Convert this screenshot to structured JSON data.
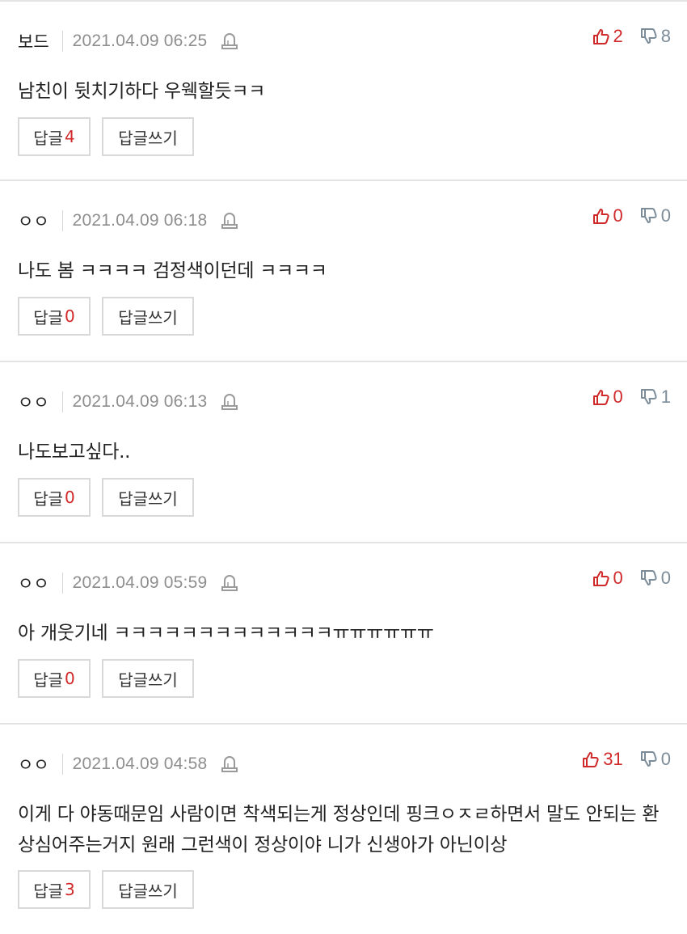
{
  "comments": [
    {
      "author": "보드",
      "date": "2021.04.09 06:25",
      "likes": "2",
      "dislikes": "8",
      "text": "남친이 뒷치기하다 우웩할듯ㅋㅋ",
      "reply_label": "답글",
      "reply_count": "4",
      "write_label": "답글쓰기"
    },
    {
      "author": "ㅇㅇ",
      "date": "2021.04.09 06:18",
      "likes": "0",
      "dislikes": "0",
      "text": "나도 봄 ㅋㅋㅋㅋ 검정색이던데 ㅋㅋㅋㅋ",
      "reply_label": "답글",
      "reply_count": "0",
      "write_label": "답글쓰기"
    },
    {
      "author": "ㅇㅇ",
      "date": "2021.04.09 06:13",
      "likes": "0",
      "dislikes": "1",
      "text": "나도보고싶다..",
      "reply_label": "답글",
      "reply_count": "0",
      "write_label": "답글쓰기"
    },
    {
      "author": "ㅇㅇ",
      "date": "2021.04.09 05:59",
      "likes": "0",
      "dislikes": "0",
      "text": "아 개웃기네 ㅋㅋㅋㅋㅋㅋㅋㅋㅋㅋㅋㅋㅋㅠㅠㅠㅠㅠㅠ",
      "reply_label": "답글",
      "reply_count": "0",
      "write_label": "답글쓰기"
    },
    {
      "author": "ㅇㅇ",
      "date": "2021.04.09 04:58",
      "likes": "31",
      "dislikes": "0",
      "text": "이게 다 야동때문임 사람이면 착색되는게 정상인데 핑크ㅇㅈㄹ하면서 말도 안되는 환상심어주는거지 원래 그런색이 정상이야 니가 신생아가 아닌이상",
      "reply_label": "답글",
      "reply_count": "3",
      "write_label": "답글쓰기"
    }
  ],
  "icons": {
    "report": "bell-icon",
    "like": "thumbs-up-icon",
    "dislike": "thumbs-down-icon"
  },
  "colors": {
    "like": "#d0292a",
    "dislike": "#7c8c99",
    "reply_count": "#d0292a",
    "divider": "#e3e3e3"
  }
}
